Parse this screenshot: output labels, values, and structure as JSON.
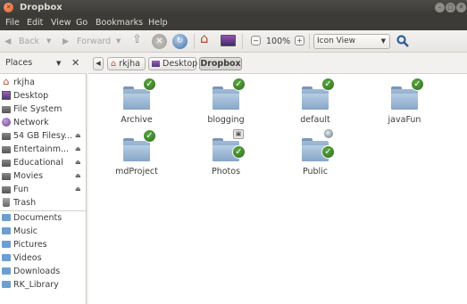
{
  "window": {
    "title": "Dropbox"
  },
  "menubar": [
    "File",
    "Edit",
    "View",
    "Go",
    "Bookmarks",
    "Help"
  ],
  "toolbar": {
    "back_label": "Back",
    "forward_label": "Forward",
    "zoom": "100%",
    "view_mode": "Icon View",
    "icons": {
      "back": "arrow-left-icon",
      "forward": "arrow-right-icon",
      "up": "arrow-up-icon",
      "stop": "stop-icon",
      "reload": "reload-icon",
      "home": "home-icon",
      "computer": "computer-icon",
      "zoom_out": "zoom-out-icon",
      "zoom_in": "zoom-in-icon",
      "search": "search-icon"
    }
  },
  "sidebar": {
    "header": "Places",
    "devices": [
      {
        "label": "rkjha",
        "icon": "home-icon"
      },
      {
        "label": "Desktop",
        "icon": "desktop-icon"
      },
      {
        "label": "File System",
        "icon": "drive-icon"
      },
      {
        "label": "Network",
        "icon": "network-icon"
      },
      {
        "label": "54 GB Filesy...",
        "icon": "drive-icon",
        "eject": true
      },
      {
        "label": "Entertainm...",
        "icon": "drive-icon",
        "eject": true
      },
      {
        "label": "Educational",
        "icon": "drive-icon",
        "eject": true
      },
      {
        "label": "Movies",
        "icon": "drive-icon",
        "eject": true
      },
      {
        "label": "Fun",
        "icon": "drive-icon",
        "eject": true
      },
      {
        "label": "Trash",
        "icon": "trash-icon"
      }
    ],
    "bookmarks": [
      "Documents",
      "Music",
      "Pictures",
      "Videos",
      "Downloads",
      "RK_Library"
    ]
  },
  "breadcrumbs": [
    "rkjha",
    "Desktop",
    "Dropbox"
  ],
  "files": [
    {
      "name": "Archive",
      "emblem": "sync-check"
    },
    {
      "name": "blogging",
      "emblem": "sync-check"
    },
    {
      "name": "default",
      "emblem": "sync-check"
    },
    {
      "name": "javaFun",
      "emblem": "sync-check"
    },
    {
      "name": "mdProject",
      "emblem": "sync-check"
    },
    {
      "name": "Photos",
      "emblem": "camera"
    },
    {
      "name": "Public",
      "emblem": "globe"
    }
  ],
  "colors": {
    "titlebar": "#3c3b37",
    "sync_ok": "#3c8a2a",
    "folder": "#7f9fc4",
    "close_button": "#e05a23"
  }
}
